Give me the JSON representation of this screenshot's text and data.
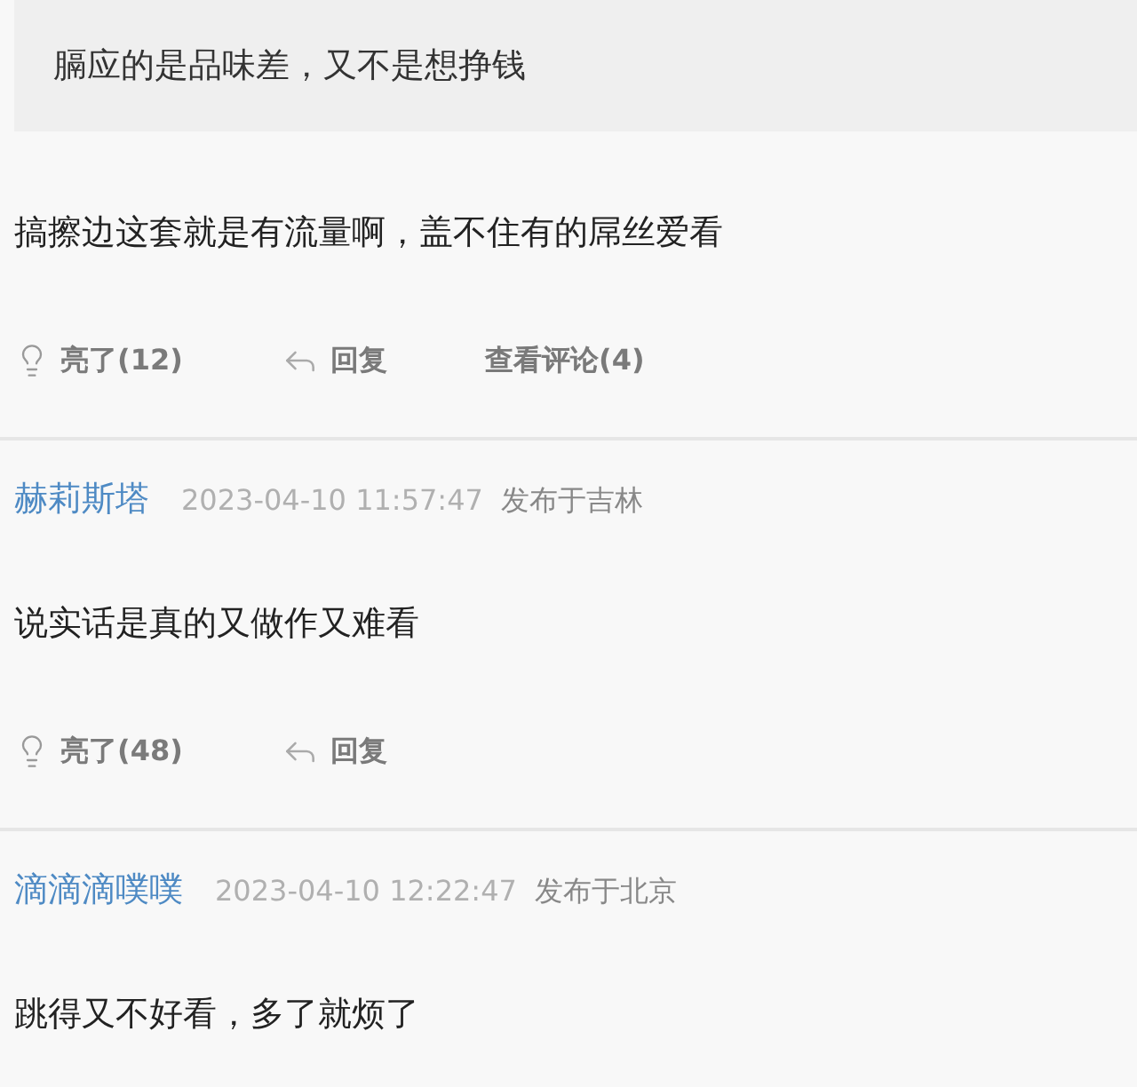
{
  "comments": [
    {
      "quote": "膈应的是品味差，又不是想挣钱",
      "text": "搞擦边这套就是有流量啊，盖不住有的屌丝爱看",
      "actions": {
        "like": "亮了(12)",
        "reply": "回复",
        "view_replies": "查看评论(4)"
      }
    },
    {
      "author": "赫莉斯塔",
      "time": "2023-04-10 11:57:47",
      "location": "发布于吉林",
      "text": "说实话是真的又做作又难看",
      "actions": {
        "like": "亮了(48)",
        "reply": "回复"
      }
    },
    {
      "author": "滴滴滴噗噗",
      "time": "2023-04-10 12:22:47",
      "location": "发布于北京",
      "text": "跳得又不好看，多了就烦了"
    }
  ]
}
